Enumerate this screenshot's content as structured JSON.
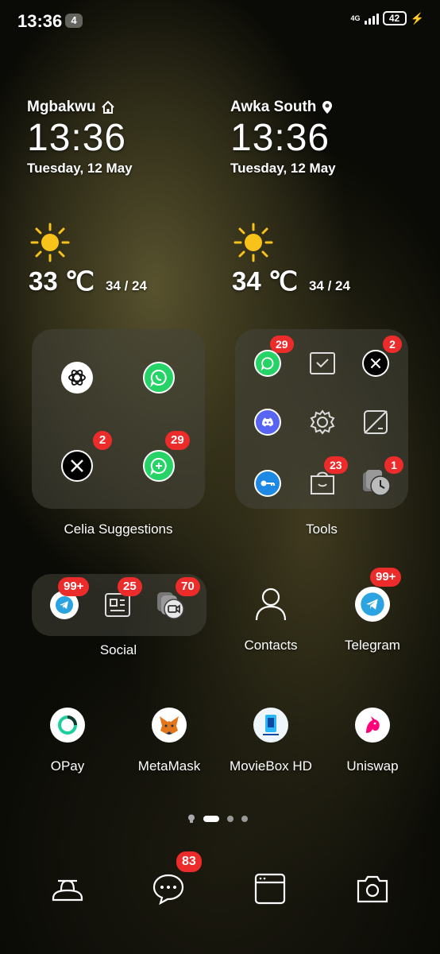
{
  "status_bar": {
    "time": "13:36",
    "notification_count": "4",
    "network": "4G",
    "battery": "42"
  },
  "clocks": [
    {
      "city": "Mgbakwu",
      "time": "13:36",
      "date": "Tuesday, 12 May",
      "temp": "33 ℃",
      "range": "34 / 24"
    },
    {
      "city": "Awka South",
      "time": "13:36",
      "date": "Tuesday, 12 May",
      "temp": "34 ℃",
      "range": "34 / 24"
    }
  ],
  "folders": {
    "celia": {
      "label": "Celia Suggestions",
      "x_badge": "2",
      "whatsapp_badge": "29"
    },
    "tools": {
      "label": "Tools",
      "whatsapp_badge": "29",
      "x_badge": "2",
      "store_badge": "23",
      "clock_badge": "1"
    },
    "social": {
      "label": "Social",
      "telegram_badge": "99+",
      "news_badge": "25",
      "video_badge": "70"
    }
  },
  "apps": {
    "contacts": {
      "label": "Contacts"
    },
    "telegram": {
      "label": "Telegram",
      "badge": "99+"
    },
    "opay": {
      "label": "OPay"
    },
    "metamask": {
      "label": "MetaMask"
    },
    "moviebox": {
      "label": "MovieBox HD"
    },
    "uniswap": {
      "label": "Uniswap"
    }
  },
  "dock": {
    "messages_badge": "83"
  }
}
